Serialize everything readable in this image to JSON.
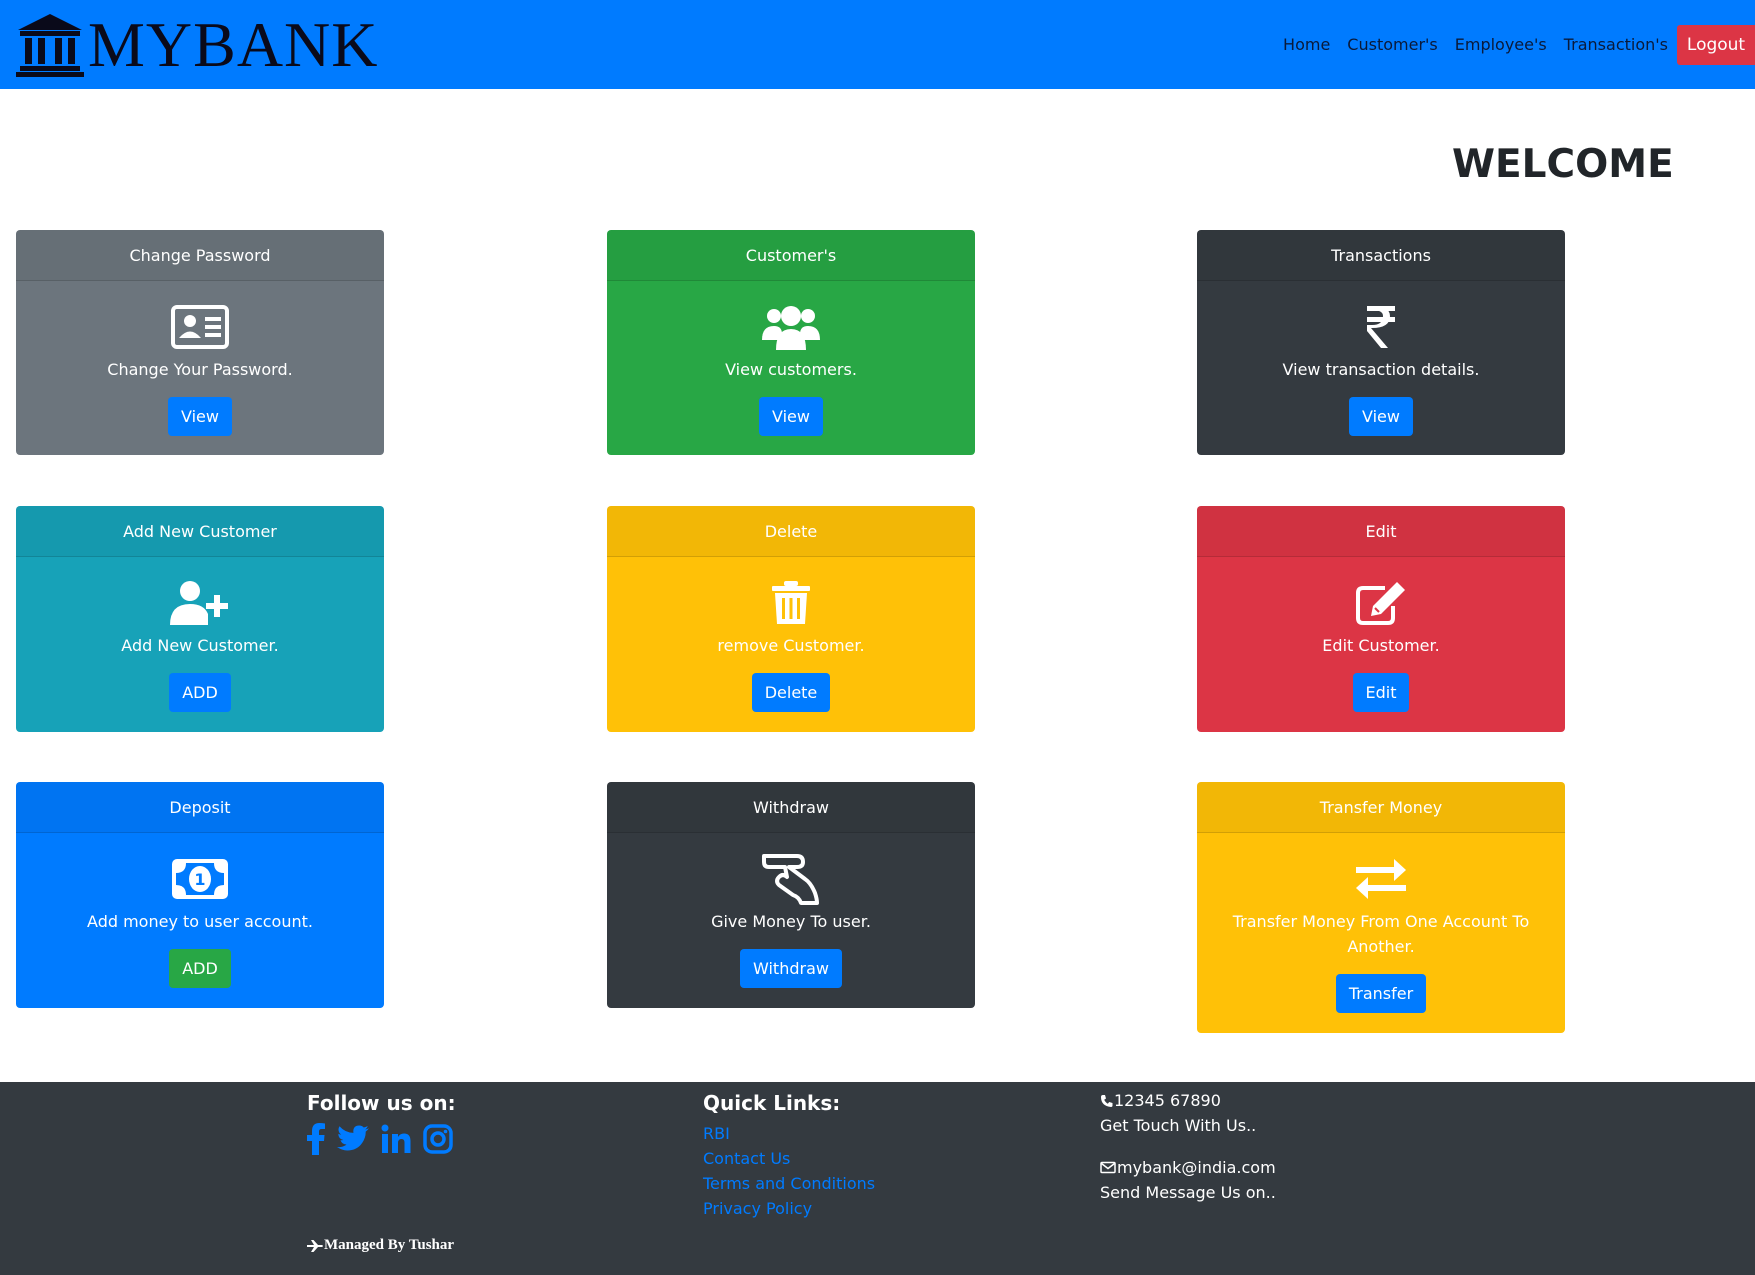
{
  "brand": {
    "name": "MYBANK",
    "icon": "bank-building-icon"
  },
  "nav": {
    "items": [
      "Home",
      "Customer's",
      "Employee's",
      "Transaction's"
    ],
    "logout": "Logout"
  },
  "welcome": "WELCOME",
  "cards": [
    {
      "header": "Change Password",
      "icon": "id-card-icon",
      "text": "Change Your Password.",
      "button": "View",
      "color": "#6c757d"
    },
    {
      "header": "Customer's",
      "icon": "users-icon",
      "text": "View customers.",
      "button": "View",
      "color": "#28a745"
    },
    {
      "header": "Transactions",
      "icon": "rupee-icon",
      "text": "View transaction details.",
      "button": "View",
      "color": "#343a40"
    },
    {
      "header": "Add New Customer",
      "icon": "user-plus-icon",
      "text": "Add New Customer.",
      "button": "ADD",
      "color": "#17a2b8"
    },
    {
      "header": "Delete",
      "icon": "trash-icon",
      "text": "remove Customer.",
      "button": "Delete",
      "color": "#ffc107"
    },
    {
      "header": "Edit",
      "icon": "edit-icon",
      "text": "Edit Customer.",
      "button": "Edit",
      "color": "#dc3545"
    },
    {
      "header": "Deposit",
      "icon": "money-bill-icon",
      "text": "Add money to user account.",
      "button": "ADD",
      "color": "#007bff"
    },
    {
      "header": "Withdraw",
      "icon": "hand-money-icon",
      "text": "Give Money To user.",
      "button": "Withdraw",
      "color": "#343a40"
    },
    {
      "header": "Transfer Money",
      "icon": "exchange-icon",
      "text": "Transfer Money From One Account To Another.",
      "button": "Transfer",
      "color": "#ffc107"
    }
  ],
  "footer": {
    "follow_title": "Follow us on:",
    "social_icons": [
      "facebook-icon",
      "twitter-icon",
      "linkedin-icon",
      "instagram-icon"
    ],
    "quick_title": "Quick Links:",
    "quick_links": [
      "RBI",
      "Contact Us",
      "Terms and Conditions",
      "Privacy Policy"
    ],
    "phone": "12345 67890",
    "phone_caption": "Get Touch With Us..",
    "email": "mybank@india.com",
    "email_caption": "Send Message Us on..",
    "managed": "Managed By Tushar"
  },
  "colors": {
    "navbar": "#007bff",
    "footer": "#343a40",
    "link": "#007bff",
    "logout": "#dc3545"
  }
}
